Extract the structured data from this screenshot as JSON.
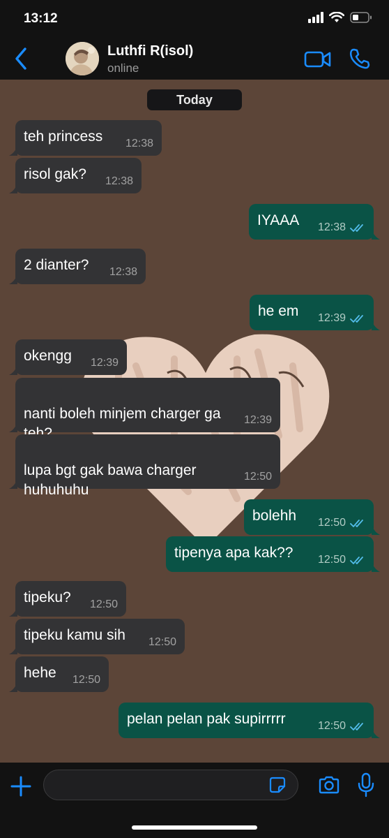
{
  "status_bar": {
    "time": "13:12"
  },
  "header": {
    "contact_name": "Luthfi R(isol)",
    "contact_status": "online"
  },
  "chat": {
    "date_label": "Today",
    "messages": [
      {
        "dir": "in",
        "text": "teh princess",
        "time": "12:38"
      },
      {
        "dir": "in",
        "text": "risol gak?",
        "time": "12:38"
      },
      {
        "dir": "out",
        "text": "IYAAA",
        "time": "12:38"
      },
      {
        "dir": "in",
        "text": "2 dianter?",
        "time": "12:38"
      },
      {
        "dir": "out",
        "text": "he em",
        "time": "12:39"
      },
      {
        "dir": "in",
        "text": "okengg",
        "time": "12:39"
      },
      {
        "dir": "in",
        "text": "nanti boleh minjem charger ga\nteh?",
        "time": "12:39"
      },
      {
        "dir": "in",
        "text": "lupa bgt gak bawa charger\nhuhuhuhu",
        "time": "12:50"
      },
      {
        "dir": "out",
        "text": "bolehh",
        "time": "12:50"
      },
      {
        "dir": "out",
        "text": "tipenya apa kak??",
        "time": "12:50"
      },
      {
        "dir": "in",
        "text": "tipeku?",
        "time": "12:50"
      },
      {
        "dir": "in",
        "text": "tipeku kamu sih",
        "time": "12:50"
      },
      {
        "dir": "in",
        "text": "hehe",
        "time": "12:50"
      },
      {
        "dir": "out",
        "text": "pelan pelan pak supirrrrr",
        "time": "12:50"
      }
    ]
  },
  "input_bar": {
    "message_value": "",
    "placeholder": ""
  },
  "colors": {
    "accent": "#1a8cff",
    "incoming_bubble": "#333335",
    "outgoing_bubble": "#0a5346",
    "wallpaper": "#5c4538",
    "read_ticks": "#53bdeb"
  },
  "icons": [
    "back-chevron-icon",
    "video-call-icon",
    "voice-call-icon",
    "plus-icon",
    "sticker-icon",
    "camera-icon",
    "microphone-icon",
    "signal-icon",
    "wifi-icon",
    "battery-icon"
  ]
}
